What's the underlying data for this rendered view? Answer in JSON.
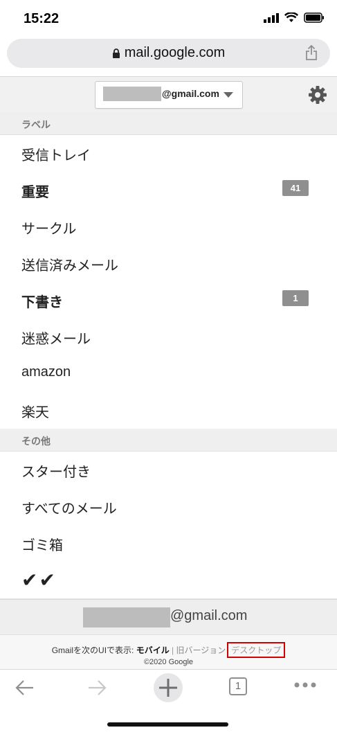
{
  "status": {
    "time": "15:22"
  },
  "browser": {
    "url": "mail.google.com",
    "tab_count": "1"
  },
  "account": {
    "domain": "@gmail.com",
    "footer_domain": "@gmail.com"
  },
  "sections": {
    "labels_header": "ラベル",
    "other_header": "その他"
  },
  "labels": [
    {
      "label": "受信トレイ",
      "bold": false
    },
    {
      "label": "重要",
      "bold": true,
      "badge": "41"
    },
    {
      "label": "サークル",
      "bold": false
    },
    {
      "label": "送信済みメール",
      "bold": false
    },
    {
      "label": "下書き",
      "bold": true,
      "badge": "1"
    },
    {
      "label": "迷惑メール",
      "bold": false
    },
    {
      "label": "amazon",
      "bold": false
    },
    {
      "label": "楽天",
      "bold": false
    }
  ],
  "others": [
    {
      "label": "スター付き"
    },
    {
      "label": "すべてのメール"
    },
    {
      "label": "ゴミ箱"
    },
    {
      "label": "✔✔"
    }
  ],
  "footer": {
    "switch_prefix": "Gmailを次のUIで表示: ",
    "mobile": "モバイル",
    "separator": " | ",
    "old_version": "旧バージョン",
    "desktop": "デスクトップ",
    "copyright": "©2020 Google"
  },
  "colors": {
    "badge": "#8f8f8f",
    "highlight_box": "#d00000",
    "section_bg": "#efefef"
  }
}
